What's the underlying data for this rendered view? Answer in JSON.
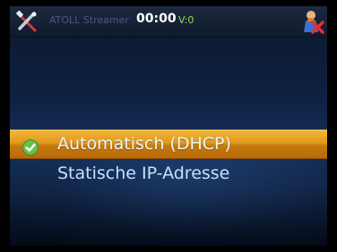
{
  "statusbar": {
    "app_title": "ATOLL Streamer",
    "time": "00:00",
    "volume": "V:0",
    "app_icon": "tools-icon",
    "exit_icon": "exit-icon"
  },
  "menu": {
    "items": [
      {
        "label": "Automatisch (DHCP)",
        "selected": true,
        "icon": "checkmark-icon"
      },
      {
        "label": "Statische IP-Adresse",
        "selected": false
      }
    ]
  },
  "colors": {
    "highlight": "#e09a1c",
    "item_text": "#bfe3ff",
    "volume_text": "#8fe04a",
    "check_green": "#6cc04a"
  }
}
